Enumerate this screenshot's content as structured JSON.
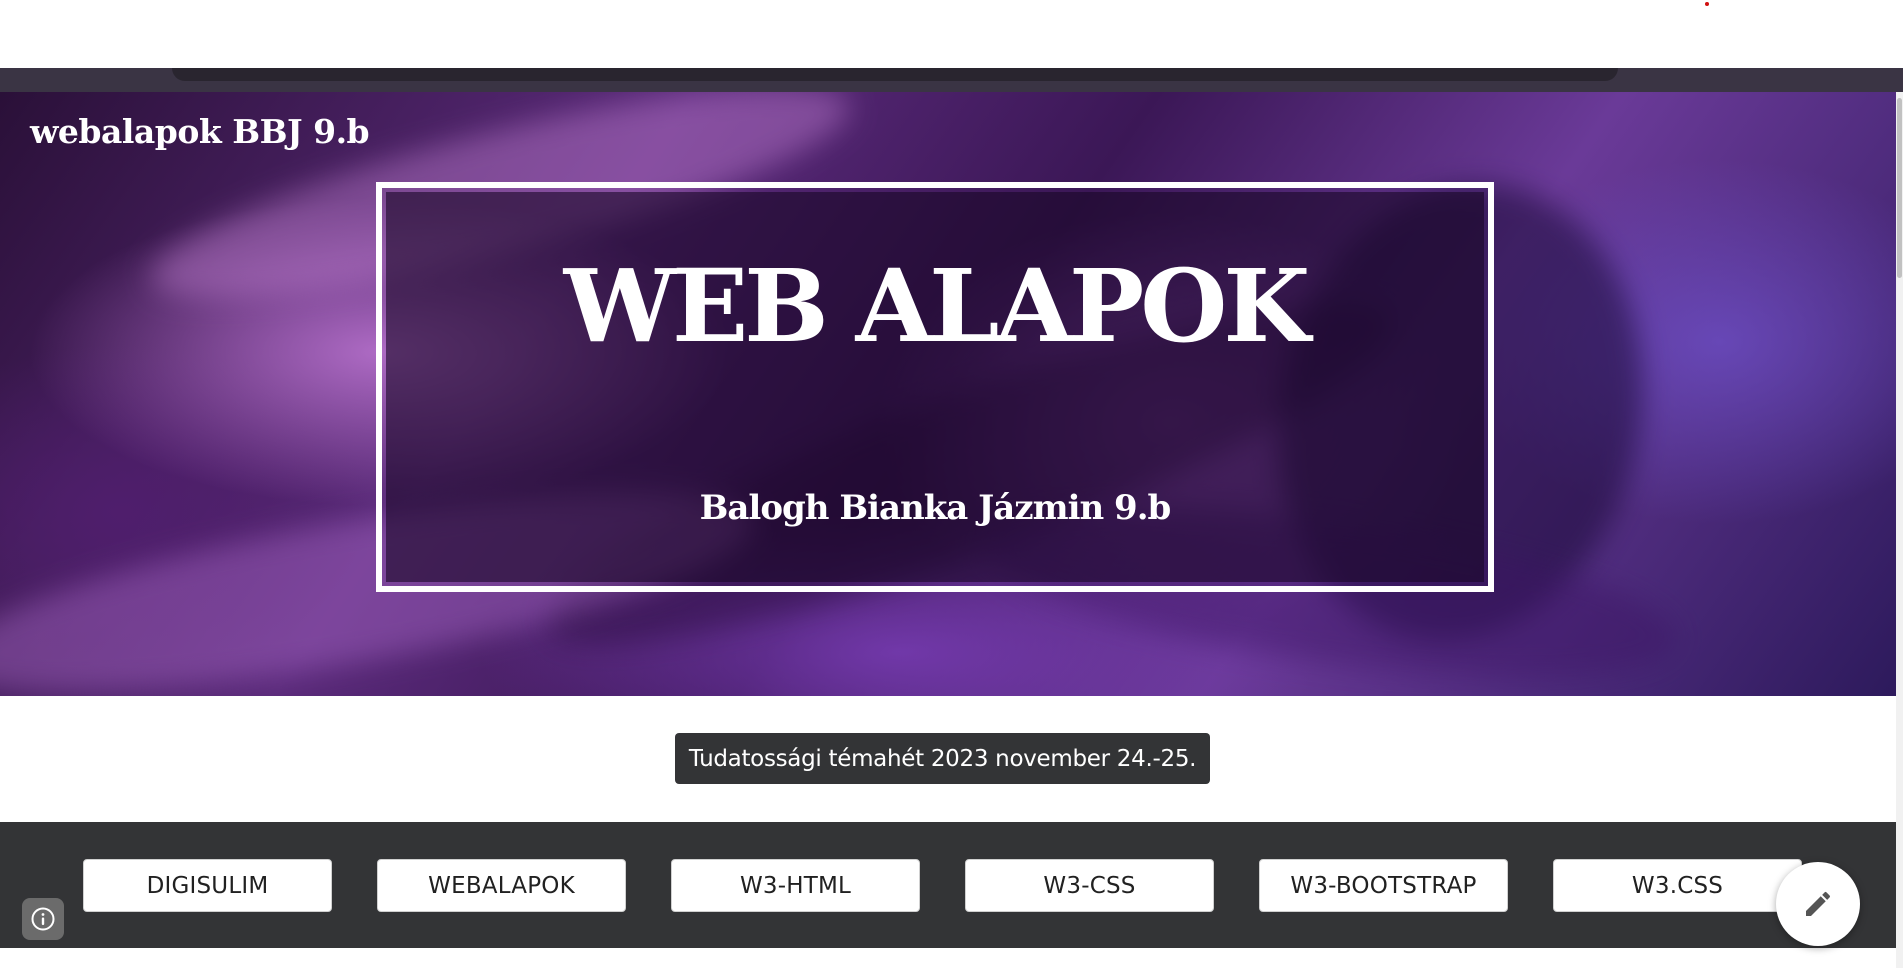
{
  "site": {
    "title": "webalapok BBJ 9.b"
  },
  "hero": {
    "heading": "WEB ALAPOK",
    "subtitle": "Balogh Bianka Jázmin 9.b"
  },
  "announcement": {
    "text": "Tudatossági témahét 2023 november 24.-25."
  },
  "nav": {
    "buttons": [
      {
        "label": "DIGISULIM"
      },
      {
        "label": "WEBALAPOK"
      },
      {
        "label": "W3-HTML"
      },
      {
        "label": "W3-CSS"
      },
      {
        "label": "W3-BOOTSTRAP"
      },
      {
        "label": "W3.CSS"
      }
    ]
  },
  "icons": {
    "info": "info-icon",
    "edit": "pencil-icon"
  },
  "colors": {
    "nav_background": "#333436",
    "hero_accent": "#6a3a98"
  }
}
